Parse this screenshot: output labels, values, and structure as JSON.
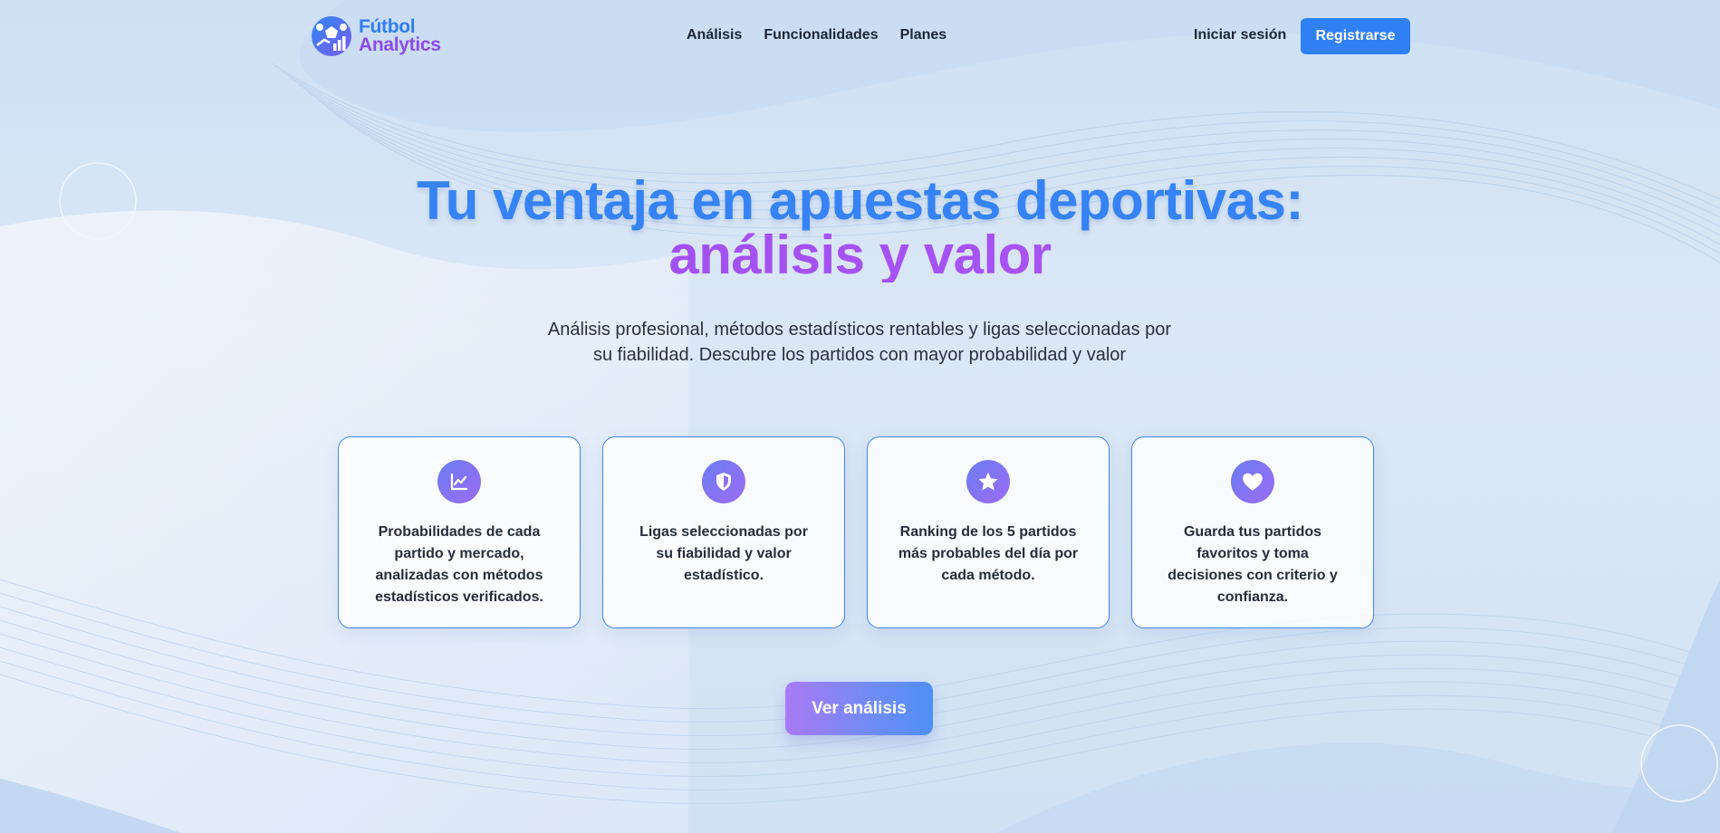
{
  "colors": {
    "primary_blue": "#2f80f3",
    "accent_purple": "#a14cf2",
    "text_dark": "#1d2636",
    "card_border": "#3f86f0"
  },
  "brand": {
    "name_line1": "Fútbol",
    "name_line2": "Analytics",
    "logo_icon": "soccer-ball-chart-icon"
  },
  "nav": {
    "items": [
      {
        "label": "Análisis"
      },
      {
        "label": "Funcionalidades"
      },
      {
        "label": "Planes"
      }
    ],
    "login_label": "Iniciar sesión",
    "register_label": "Registrarse"
  },
  "hero": {
    "title_line1": "Tu ventaja en apuestas deportivas:",
    "title_line2": "análisis y valor",
    "subtitle": "Análisis profesional, métodos estadísticos rentables y ligas seleccionadas por su fiabilidad. Descubre los partidos con mayor probabilidad y valor"
  },
  "features": [
    {
      "icon": "chart-line-icon",
      "text": "Probabilidades de cada partido y mercado, analizadas con métodos estadísticos verificados."
    },
    {
      "icon": "shield-icon",
      "text": "Ligas seleccionadas por su fiabilidad y valor estadístico."
    },
    {
      "icon": "star-icon",
      "text": "Ranking de los 5 partidos más probables del día por cada método."
    },
    {
      "icon": "heart-icon",
      "text": "Guarda tus partidos favoritos y toma decisiones con criterio y confianza."
    }
  ],
  "cta": {
    "label": "Ver análisis"
  }
}
